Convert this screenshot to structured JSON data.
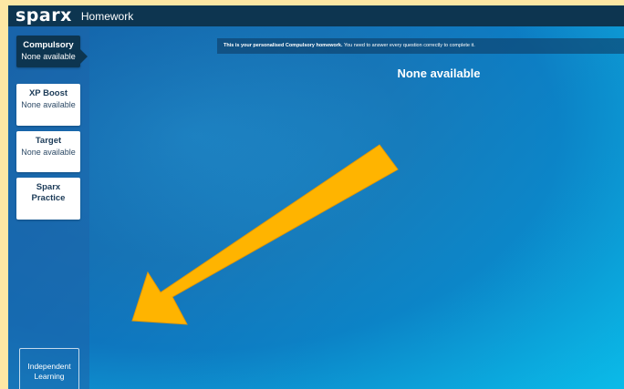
{
  "header": {
    "logo": "sparx",
    "section_title": "Homework"
  },
  "sidebar": {
    "items": [
      {
        "title": "Compulsory",
        "subtitle": "None available"
      },
      {
        "title": "XP Boost",
        "subtitle": "None available"
      },
      {
        "title": "Target",
        "subtitle": "None available"
      },
      {
        "title": "Sparx",
        "subtitle": "Practice"
      }
    ],
    "independent": {
      "line1": "Independent",
      "line2": "Learning"
    }
  },
  "main": {
    "notice_bold": "This is your personalised Compulsory homework.",
    "notice_rest": " You need to answer every question correctly to complete it.",
    "heading": "None available"
  },
  "colors": {
    "frame": "#fde7a4",
    "topbar": "#0d3550",
    "arrow": "#ffb400"
  },
  "icons": {
    "pointer": "arrow-icon"
  }
}
